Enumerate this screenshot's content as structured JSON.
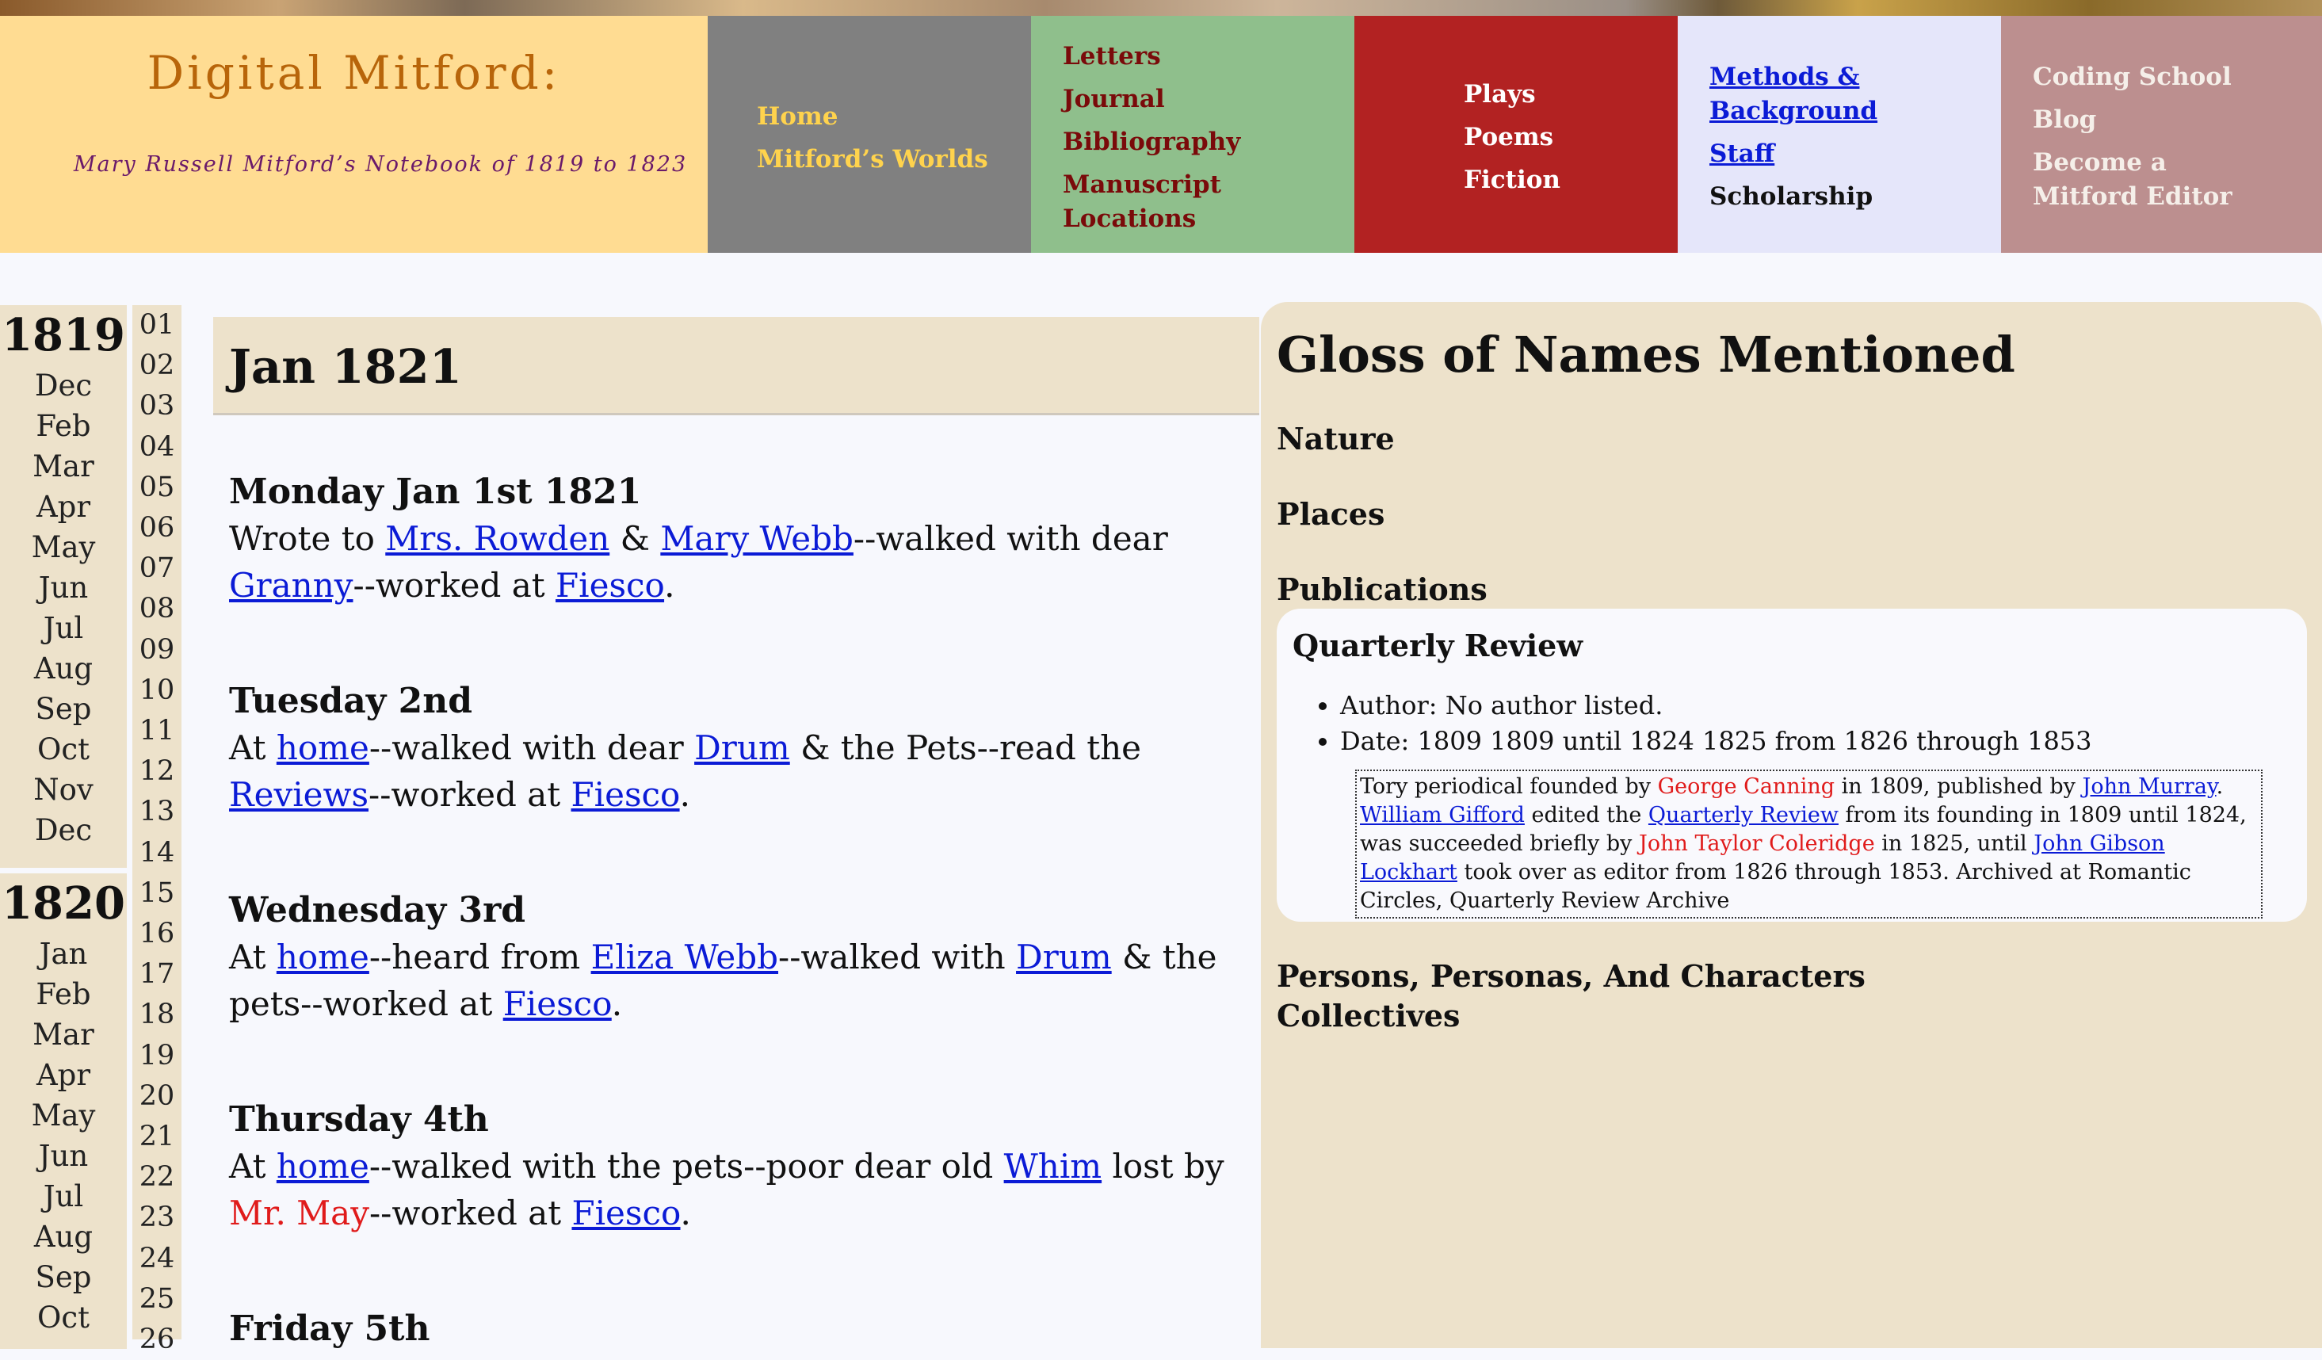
{
  "header": {
    "site_title": "Digital Mitford:",
    "subtitle": "Mary Russell Mitford’s Notebook of 1819 to 1823",
    "nav_gray": [
      "Home",
      "Mitford’s Worlds"
    ],
    "nav_green": [
      "Letters",
      "Journal",
      "Bibliography",
      "Manuscript Locations"
    ],
    "nav_red": [
      "Plays",
      "Poems",
      "Fiction"
    ],
    "nav_lav": [
      "Methods & Background",
      "Staff",
      "Scholarship"
    ],
    "nav_rose": [
      "Coding School",
      "Blog",
      "Become a Mitford Editor"
    ]
  },
  "sidebar": {
    "year_1819": "1819",
    "months_1819": [
      "Dec",
      "Feb",
      "Mar",
      "Apr",
      "May",
      "Jun",
      "Jul",
      "Aug",
      "Sep",
      "Oct",
      "Nov",
      "Dec"
    ],
    "year_1820": "1820",
    "months_1820": [
      "Jan",
      "Feb",
      "Mar",
      "Apr",
      "May",
      "Jun",
      "Jul",
      "Aug",
      "Sep",
      "Oct"
    ],
    "days": [
      "01",
      "02",
      "03",
      "04",
      "05",
      "06",
      "07",
      "08",
      "09",
      "10",
      "11",
      "12",
      "13",
      "14",
      "15",
      "16",
      "17",
      "18",
      "19",
      "20",
      "21",
      "22",
      "23",
      "24",
      "25",
      "26"
    ]
  },
  "main": {
    "month_title": "Jan 1821",
    "e1": {
      "date": "Monday Jan 1st 1821",
      "t1": "Wrote to ",
      "l1": "Mrs. Rowden",
      "t2": " & ",
      "l2": "Mary Webb",
      "t3": "--walked with dear ",
      "l3": "Granny",
      "t4": "--worked at ",
      "l4": "Fiesco",
      "t5": "."
    },
    "e2": {
      "date": "Tuesday 2nd",
      "t1": "At ",
      "l1": "home",
      "t2": "--walked with dear ",
      "l2": "Drum",
      "t3": " & the Pets--read the ",
      "l3": "Reviews",
      "t4": "--worked at ",
      "l4": "Fiesco",
      "t5": "."
    },
    "e3": {
      "date": "Wednesday 3rd",
      "t1": "At ",
      "l1": "home",
      "t2": "--heard from ",
      "l2": "Eliza Webb",
      "t3": "--walked with ",
      "l3": "Drum",
      "t4": " & the pets--worked at ",
      "l4": "Fiesco",
      "t5": "."
    },
    "e4": {
      "date": "Thursday 4th",
      "t1": "At ",
      "l1": "home",
      "t2": "--walked with the pets--poor dear old ",
      "l2": "Whim",
      "t3": " lost by ",
      "r1": "Mr. May",
      "t4": "--worked at ",
      "l4": "Fiesco",
      "t5": "."
    },
    "e5": {
      "date": "Friday 5th"
    }
  },
  "gloss": {
    "title": "Gloss of Names Mentioned",
    "sections": [
      "Nature",
      "Places",
      "Publications"
    ],
    "card": {
      "title": "Quarterly Review",
      "author": "Author: No author listed.",
      "date": "Date: 1809 1809 until 1824 1825 from 1826 through 1853",
      "d1": "Tory periodical founded by ",
      "r1": "George Canning",
      "d2": " in 1809, published by ",
      "l1": "John Murray",
      "d3": ". ",
      "l2": "William Gifford",
      "d4": " edited the ",
      "l3": "Quarterly Review",
      "d5": " from its founding in 1809 until 1824, was succeeded briefly by ",
      "r2": "John Taylor Coleridge",
      "d6": " in 1825, until ",
      "l4": "John Gibson Lockhart",
      "d7": " took over as editor from 1826 through 1853. Archived at Romantic Circles, Quarterly Review Archive"
    },
    "persons": "Persons, Personas, And Characters",
    "collectives": "Collectives"
  }
}
